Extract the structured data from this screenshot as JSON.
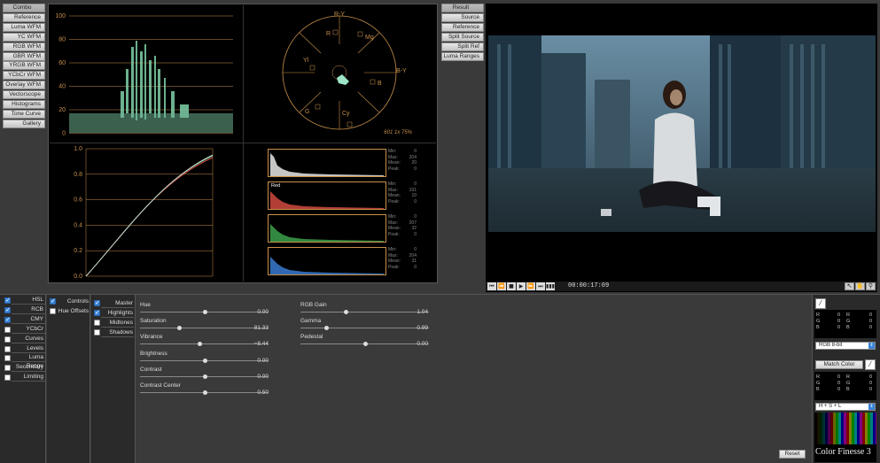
{
  "left_views": [
    "Combo",
    "Reference",
    "Luma WFM",
    "YC WFM",
    "RGB WFM",
    "GBR WFM",
    "YRGB WFM",
    "YCbCr WFM",
    "Overlay WFM",
    "Vectorscope",
    "Histograms",
    "Tone Curve",
    "Gallery"
  ],
  "right_views": [
    "Result",
    "Source",
    "Reference",
    "Split Source",
    "Split Ref",
    "Luma Ranges"
  ],
  "wfm": {
    "ticks": [
      "100",
      "80",
      "60",
      "40",
      "20",
      "0"
    ]
  },
  "vectorscope": {
    "labels": [
      "R-Y",
      "R",
      "Mg",
      "Yl",
      "B-Y",
      "B",
      "G",
      "Cy"
    ],
    "footer": "601 1x 75%"
  },
  "tonecurve": {
    "ticks": [
      "1.0",
      "0.8",
      "0.6",
      "0.4",
      "0.2",
      "0.0"
    ]
  },
  "histograms": [
    {
      "name": "",
      "stats": [
        "0",
        "204",
        "20",
        "0"
      ]
    },
    {
      "name": "Red",
      "stats": [
        "0",
        "191",
        "10",
        "0"
      ]
    },
    {
      "name": "",
      "stats": [
        "0",
        "207",
        "32",
        "0"
      ]
    },
    {
      "name": "",
      "stats": [
        "0",
        "204",
        "31",
        "0"
      ]
    }
  ],
  "hist_labels": [
    "Min:",
    "Max:",
    "Mean:",
    "Peak:"
  ],
  "transport": {
    "timecode": "00:00:17:09"
  },
  "categories": [
    {
      "label": "HSL",
      "checked": true
    },
    {
      "label": "RCB",
      "checked": true
    },
    {
      "label": "CMY",
      "checked": true
    },
    {
      "label": "YCbCr",
      "checked": false
    },
    {
      "label": "Curves",
      "checked": false
    },
    {
      "label": "Levels",
      "checked": false
    },
    {
      "label": "Luma Range",
      "checked": false
    },
    {
      "label": "Secondary",
      "checked": false
    },
    {
      "label": "Limiting",
      "checked": false
    }
  ],
  "col2": [
    {
      "label": "Controls",
      "checked": true
    },
    {
      "label": "Hue Offsets",
      "checked": false
    }
  ],
  "col3": [
    {
      "label": "Master",
      "checked": true
    },
    {
      "label": "Highlights",
      "checked": true
    },
    {
      "label": "Midtones",
      "checked": false
    },
    {
      "label": "Shadows",
      "checked": false
    }
  ],
  "sliders_left": [
    {
      "label": "Hue",
      "value": "0.00",
      "pos": 0.5
    },
    {
      "label": "Saturation",
      "value": "81.33",
      "pos": 0.3
    },
    {
      "label": "Vibrance",
      "value": "−8.44",
      "pos": 0.46
    },
    {
      "label": "Brightness",
      "value": "0.00",
      "pos": 0.5
    },
    {
      "label": "Contrast",
      "value": "0.00",
      "pos": 0.5
    },
    {
      "label": "Contrast Center",
      "value": "0.50",
      "pos": 0.5
    }
  ],
  "sliders_right": [
    {
      "label": "RGB Gain",
      "value": "1.04",
      "pos": 0.35
    },
    {
      "label": "Gamma",
      "value": "0.99",
      "pos": 0.2
    },
    {
      "label": "Pedestal",
      "value": "0.00",
      "pos": 0.5
    }
  ],
  "reset_label": "Reset",
  "picker": {
    "rgb1": [
      [
        "R",
        "0",
        "R",
        "0"
      ],
      [
        "G",
        "0",
        "G",
        "0"
      ],
      [
        "B",
        "0",
        "B",
        "0"
      ]
    ],
    "mode1": "RGB 8-bit",
    "match": "Match Color",
    "rgb2": [
      [
        "R",
        "0",
        "R",
        "0"
      ],
      [
        "G",
        "0",
        "G",
        "0"
      ],
      [
        "B",
        "0",
        "B",
        "0"
      ]
    ],
    "mode2": "H + S + L"
  },
  "brand": "Color Finesse 3"
}
